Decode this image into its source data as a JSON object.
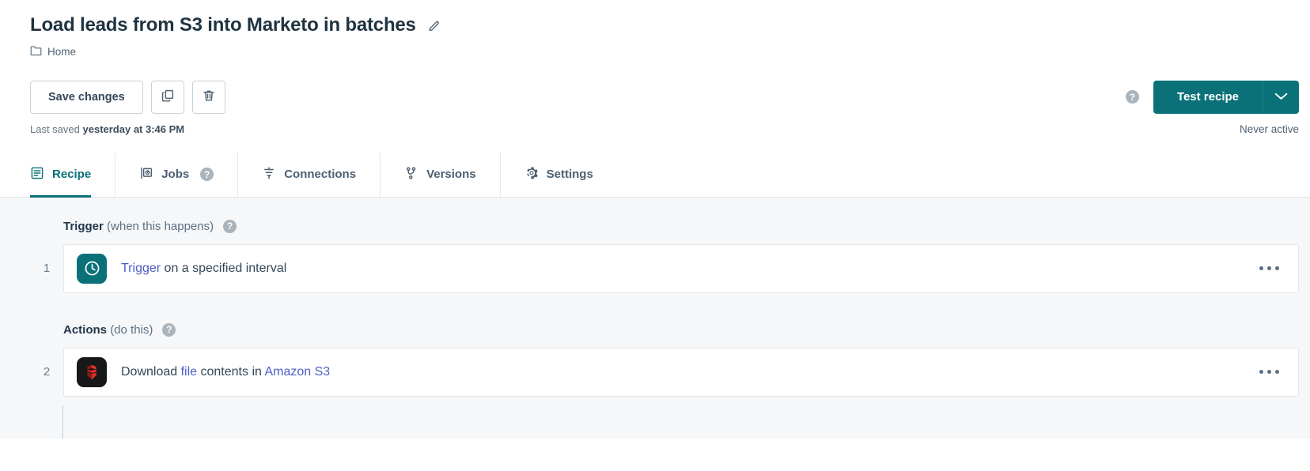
{
  "header": {
    "title": "Load leads from S3 into Marketo in batches",
    "edit_icon": "pencil-icon",
    "breadcrumb": {
      "folder_icon": "folder-icon",
      "label": "Home"
    }
  },
  "toolbar": {
    "save_label": "Save changes",
    "copy_icon": "copy-icon",
    "delete_icon": "trash-icon",
    "help_icon": "help-circle-icon",
    "test_label": "Test recipe",
    "caret_icon": "chevron-down-icon",
    "primary_color": "#0a7179"
  },
  "status": {
    "saved_prefix": "Last saved ",
    "saved_time": "yesterday at 3:46 PM",
    "activity": "Never active"
  },
  "tabs": [
    {
      "label": "Recipe",
      "icon": "recipe-list-icon",
      "active": true,
      "help": false
    },
    {
      "label": "Jobs",
      "icon": "jobs-icon",
      "active": false,
      "help": true
    },
    {
      "label": "Connections",
      "icon": "connections-icon",
      "active": false,
      "help": false
    },
    {
      "label": "Versions",
      "icon": "git-branch-icon",
      "active": false,
      "help": false
    },
    {
      "label": "Settings",
      "icon": "gear-icon",
      "active": false,
      "help": false
    }
  ],
  "recipe": {
    "trigger_section": {
      "name": "Trigger",
      "subtitle": "(when this happens)",
      "help_icon": "help-circle-icon"
    },
    "trigger_step": {
      "number": "1",
      "icon": "clock-icon",
      "icon_bg": "#0a7179",
      "text_link": "Trigger",
      "text_rest": " on a specified interval",
      "menu_icon": "ellipsis-icon"
    },
    "actions_section": {
      "name": "Actions",
      "subtitle": "(do this)",
      "help_icon": "help-circle-icon"
    },
    "action_step": {
      "number": "2",
      "icon": "amazon-s3-icon",
      "icon_bg": "#17181a",
      "text_lead": "Download ",
      "text_link1": "file",
      "text_mid": " contents in ",
      "text_link2": "Amazon S3",
      "menu_icon": "ellipsis-icon"
    }
  }
}
